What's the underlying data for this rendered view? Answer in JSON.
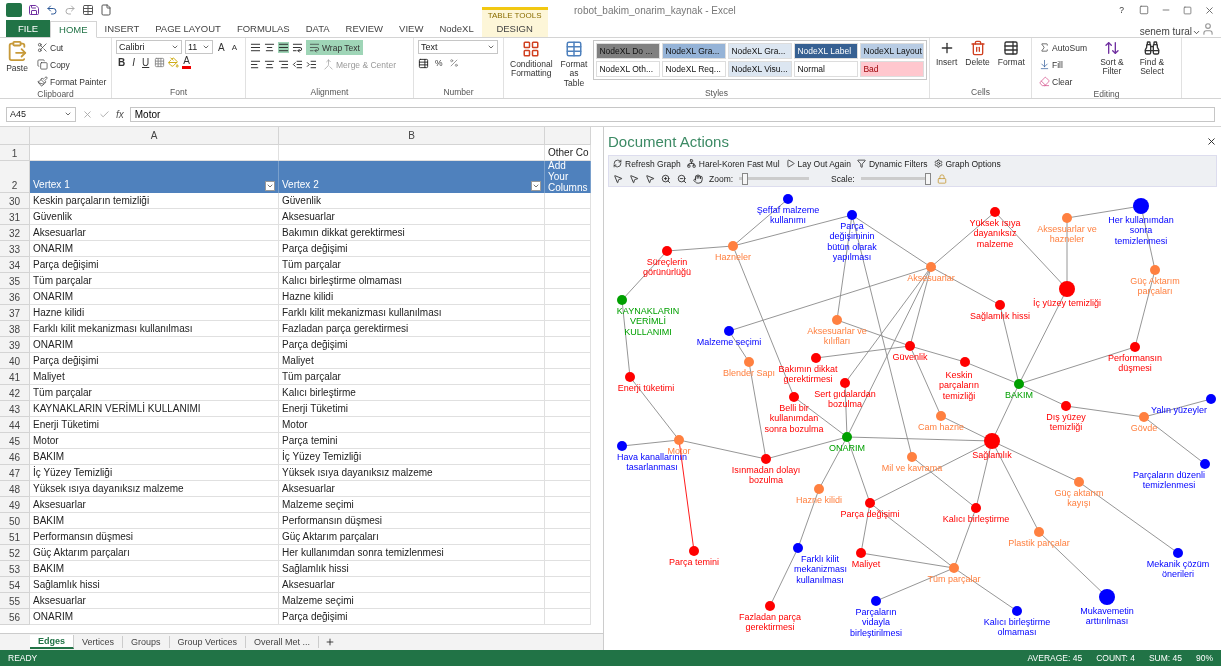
{
  "title_bar": {
    "title": "robot_bakim_onarim_kaynak - Excel",
    "user": "senem tural",
    "help": "?"
  },
  "contextual_group": "TABLE TOOLS",
  "tabs": [
    {
      "label": "FILE",
      "kind": "file",
      "selected": false
    },
    {
      "label": "HOME",
      "kind": "tab",
      "selected": true
    },
    {
      "label": "INSERT",
      "kind": "tab",
      "selected": false
    },
    {
      "label": "PAGE LAYOUT",
      "kind": "tab",
      "selected": false
    },
    {
      "label": "FORMULAS",
      "kind": "tab",
      "selected": false
    },
    {
      "label": "DATA",
      "kind": "tab",
      "selected": false
    },
    {
      "label": "REVIEW",
      "kind": "tab",
      "selected": false
    },
    {
      "label": "VIEW",
      "kind": "tab",
      "selected": false
    },
    {
      "label": "NodeXL",
      "kind": "tab",
      "selected": false
    },
    {
      "label": "DESIGN",
      "kind": "contextual",
      "selected": false
    }
  ],
  "ribbon": {
    "clipboard": {
      "paste": "Paste",
      "cut": "Cut",
      "copy": "Copy",
      "format_painter": "Format Painter",
      "label": "Clipboard"
    },
    "font": {
      "name": "Calibri",
      "size": "11",
      "grow": "A",
      "shrink": "A",
      "bold": "B",
      "italic": "I",
      "underline": "U",
      "font_color": "A",
      "label": "Font"
    },
    "alignment": {
      "wrap_text": "Wrap Text",
      "wrap_on": true,
      "merge": "Merge & Center",
      "merge_disabled": true,
      "label": "Alignment"
    },
    "number": {
      "format": "Text",
      "percent": "%",
      "label": "Number"
    },
    "styles": {
      "conditional": "Conditional Formatting",
      "format_table": "Format as Table",
      "label": "Styles",
      "items": [
        {
          "label": "NodeXL Do ...",
          "color": "#808080"
        },
        {
          "label": "NodeXL Gra...",
          "color": "#95b3d7"
        },
        {
          "label": "NodeXL Gra...",
          "color": "#dce6f1"
        },
        {
          "label": "NodeXL Label",
          "color": "#366092"
        },
        {
          "label": "NodeXL Layout",
          "color": "#b8cce4"
        },
        {
          "label": "NodeXL Oth...",
          "color": "#ffffff"
        },
        {
          "label": "NodeXL Req...",
          "color": "#ffffff"
        },
        {
          "label": "NodeXL Visu...",
          "color": "#dce6f1"
        },
        {
          "label": "Normal",
          "color": "#ffffff"
        },
        {
          "label": "Bad",
          "color": "#ffc7ce"
        }
      ]
    },
    "cells": {
      "insert": "Insert",
      "delete": "Delete",
      "format": "Format",
      "label": "Cells"
    },
    "editing": {
      "autosum": "AutoSum",
      "fill": "Fill",
      "clear": "Clear",
      "sort": "Sort & Filter",
      "find": "Find & Select",
      "label": "Editing"
    }
  },
  "formula_bar": {
    "name_box": "A45",
    "fx": "fx",
    "value": "Motor"
  },
  "sheet": {
    "column_headers": [
      "A",
      "B"
    ],
    "row1": {
      "number": "1",
      "c": "Other Co"
    },
    "header": {
      "number": "2",
      "a": "Vertex 1",
      "b": "Vertex 2",
      "c": "Add Your Columns"
    },
    "rows": [
      {
        "n": "30",
        "a": "Keskin parçaların temizliği",
        "b": "Güvenlik"
      },
      {
        "n": "31",
        "a": "Güvenlik",
        "b": "Aksesuarlar"
      },
      {
        "n": "32",
        "a": "Aksesuarlar",
        "b": "Bakımın dikkat gerektirmesi"
      },
      {
        "n": "33",
        "a": "ONARIM",
        "b": "Parça değişimi"
      },
      {
        "n": "34",
        "a": "Parça değişimi",
        "b": "Tüm parçalar"
      },
      {
        "n": "35",
        "a": "Tüm parçalar",
        "b": "Kalıcı birleştirme olmaması"
      },
      {
        "n": "36",
        "a": "ONARIM",
        "b": "Hazne kilidi"
      },
      {
        "n": "37",
        "a": "Hazne kilidi",
        "b": "Farklı kilit mekanizması kullanılması"
      },
      {
        "n": "38",
        "a": "Farklı kilit mekanizması kullanılması",
        "b": "Fazladan parça gerektirmesi"
      },
      {
        "n": "39",
        "a": "ONARIM",
        "b": "Parça değişimi"
      },
      {
        "n": "40",
        "a": "Parça değişimi",
        "b": "Maliyet"
      },
      {
        "n": "41",
        "a": "Maliyet",
        "b": "Tüm parçalar"
      },
      {
        "n": "42",
        "a": "Tüm parçalar",
        "b": "Kalıcı birleştirme"
      },
      {
        "n": "43",
        "a": "KAYNAKLARIN VERİMLİ KULLANIMI",
        "b": "Enerji Tüketimi"
      },
      {
        "n": "44",
        "a": "Enerji Tüketimi",
        "b": "Motor"
      },
      {
        "n": "45",
        "a": "Motor",
        "b": "Parça temini"
      },
      {
        "n": "46",
        "a": "BAKIM",
        "b": "İç Yüzey Temizliği"
      },
      {
        "n": "47",
        "a": "İç Yüzey Temizliği",
        "b": "Yüksek ısıya dayanıksız malzeme"
      },
      {
        "n": "48",
        "a": "Yüksek ısıya dayanıksız malzeme",
        "b": "Aksesuarlar"
      },
      {
        "n": "49",
        "a": "Aksesuarlar",
        "b": "Malzeme seçimi"
      },
      {
        "n": "50",
        "a": "BAKIM",
        "b": "Performansın düşmesi"
      },
      {
        "n": "51",
        "a": "Performansın düşmesi",
        "b": "Güç Aktarım parçaları"
      },
      {
        "n": "52",
        "a": "Güç Aktarım parçaları",
        "b": "Her kullanımdan sonra temizlenmesi"
      },
      {
        "n": "53",
        "a": "BAKIM",
        "b": "Sağlamlık hissi"
      },
      {
        "n": "54",
        "a": "Sağlamlık hissi",
        "b": "Aksesuarlar"
      },
      {
        "n": "55",
        "a": "Aksesuarlar",
        "b": "Malzeme seçimi"
      },
      {
        "n": "56",
        "a": "ONARIM",
        "b": "Parça değişimi"
      }
    ]
  },
  "document_actions": {
    "title": "Document Actions",
    "toolbar": [
      "Refresh Graph",
      "Harel-Koren Fast Mul",
      "Lay Out Again",
      "Dynamic Filters",
      "Graph Options"
    ],
    "zoom": {
      "label": "Zoom:",
      "level": 0.05
    },
    "scale": {
      "label": "Scale:",
      "level": 1
    },
    "nodes": [
      {
        "label": "Şeffaf malzeme kullanımı",
        "color": "#0000ff"
      },
      {
        "label": "Parça değişiminin bütün olarak yapılması",
        "color": "#0000ff"
      },
      {
        "label": "Yüksek ısıya dayanıksız malzeme",
        "color": "#ff0000"
      },
      {
        "label": "Aksesuarlar ve hazneler",
        "color": "#ff8040"
      },
      {
        "label": "Her kullanımdan sonra temizlenmesi",
        "color": "#0000ff"
      },
      {
        "label": "Süreçlerin görünürlüğü",
        "color": "#ff0000"
      },
      {
        "label": "Hazneler",
        "color": "#ff8040"
      },
      {
        "label": "Aksesuarlar",
        "color": "#ff8040"
      },
      {
        "label": "Güç Aktarım parçaları",
        "color": "#ff8040"
      },
      {
        "label": "İç yüzey temizliği",
        "color": "#ff0000"
      },
      {
        "label": "KAYNAKLARIN VERİMLİ KULLANIMI",
        "color": "#00a000"
      },
      {
        "label": "Sağlamlık hissi",
        "color": "#ff0000"
      },
      {
        "label": "Malzeme seçimi",
        "color": "#0000ff"
      },
      {
        "label": "Aksesuarlar ve kılıfları",
        "color": "#ff8040"
      },
      {
        "label": "Güvenlik",
        "color": "#ff0000"
      },
      {
        "label": "Performansın düşmesi",
        "color": "#ff0000"
      },
      {
        "label": "Enerji tüketimi",
        "color": "#ff0000"
      },
      {
        "label": "Blender Sapı",
        "color": "#ff8040"
      },
      {
        "label": "Bakımın dikkat gerektirmesi",
        "color": "#ff0000"
      },
      {
        "label": "Keskin parçaların temizliği",
        "color": "#ff0000"
      },
      {
        "label": "Sert gıdalardan bozulma",
        "color": "#ff0000"
      },
      {
        "label": "BAKIM",
        "color": "#00a000"
      },
      {
        "label": "Belli bir kullanımdan sonra bozulma",
        "color": "#ff0000"
      },
      {
        "label": "Cam hazne",
        "color": "#ff8040"
      },
      {
        "label": "Dış yüzey temizliği",
        "color": "#ff0000"
      },
      {
        "label": "Gövde",
        "color": "#ff8040"
      },
      {
        "label": "Yalın yüzeyler",
        "color": "#0000ff"
      },
      {
        "label": "Motor",
        "color": "#ff8040"
      },
      {
        "label": "Hava kanallarının tasarlanması",
        "color": "#0000ff"
      },
      {
        "label": "ONARIM",
        "color": "#00a000"
      },
      {
        "label": "Sağlamlık",
        "color": "#ff0000"
      },
      {
        "label": "Isınmadan dolayı bozulma",
        "color": "#ff0000"
      },
      {
        "label": "Mil ve kavrama",
        "color": "#ff8040"
      },
      {
        "label": "Parçaların düzenli temizlenmesi",
        "color": "#0000ff"
      },
      {
        "label": "Hazne kilidi",
        "color": "#ff8040"
      },
      {
        "label": "Güç aktarım kayışı",
        "color": "#ff8040"
      },
      {
        "label": "Parça değişimi",
        "color": "#ff0000"
      },
      {
        "label": "Kalıcı birleştirme",
        "color": "#ff0000"
      },
      {
        "label": "Plastik parçalar",
        "color": "#ff8040"
      },
      {
        "label": "Parça temini",
        "color": "#ff0000"
      },
      {
        "label": "Farklı kilit mekanizması kullanılması",
        "color": "#0000ff"
      },
      {
        "label": "Maliyet",
        "color": "#ff0000"
      },
      {
        "label": "Mekanik çözüm önerileri",
        "color": "#0000ff"
      },
      {
        "label": "Tüm parçalar",
        "color": "#ff8040"
      },
      {
        "label": "Fazladan parça gerektirmesi",
        "color": "#ff0000"
      },
      {
        "label": "Parçaların vidayla birleştirilmesi",
        "color": "#0000ff"
      },
      {
        "label": "Kalıcı birleştirme olmaması",
        "color": "#0000ff"
      },
      {
        "label": "Mukavemetin arttırılması",
        "color": "#0000ff"
      }
    ]
  },
  "sheet_tabs": [
    {
      "label": "Edges",
      "selected": true
    },
    {
      "label": "Vertices",
      "selected": false
    },
    {
      "label": "Groups",
      "selected": false
    },
    {
      "label": "Group Vertices",
      "selected": false
    },
    {
      "label": "Overall Met ...",
      "selected": false
    }
  ],
  "status_bar": {
    "state": "READY",
    "average": "AVERAGE: 45",
    "count": "COUNT: 4",
    "sum": "SUM: 45",
    "zoom": "90%"
  }
}
